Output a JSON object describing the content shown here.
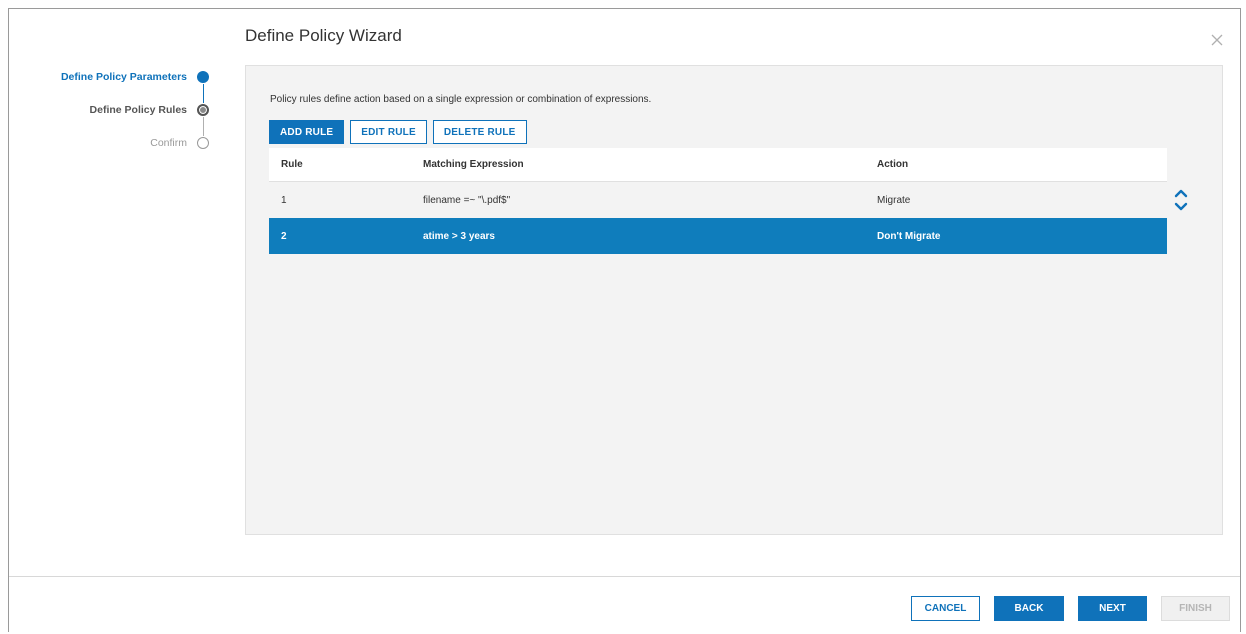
{
  "wizard": {
    "title": "Define Policy Wizard"
  },
  "steps": [
    {
      "label": "Define Policy Parameters",
      "state": "complete"
    },
    {
      "label": "Define Policy Rules",
      "state": "current"
    },
    {
      "label": "Confirm",
      "state": "pending"
    }
  ],
  "content": {
    "description": "Policy rules define action based on a single expression or combination of expressions.",
    "buttons": {
      "add": "ADD RULE",
      "edit": "EDIT RULE",
      "delete": "DELETE RULE"
    },
    "table": {
      "columns": [
        "Rule",
        "Matching Expression",
        "Action"
      ],
      "rows": [
        {
          "rule": "1",
          "expression": "filename =~ \"\\.pdf$\"",
          "action": "Migrate",
          "selected": false
        },
        {
          "rule": "2",
          "expression": "atime > 3 years",
          "action": "Don't Migrate",
          "selected": true
        }
      ]
    }
  },
  "footer": {
    "cancel": "CANCEL",
    "back": "BACK",
    "next": "NEXT",
    "finish": "FINISH"
  },
  "colors": {
    "accent": "#0f72ba",
    "selected_row": "#0f7dbc",
    "panel_bg": "#f3f3f3",
    "disabled": "#b5b5b5"
  },
  "icons": [
    "close-icon",
    "chevron-up-icon",
    "chevron-down-icon"
  ]
}
